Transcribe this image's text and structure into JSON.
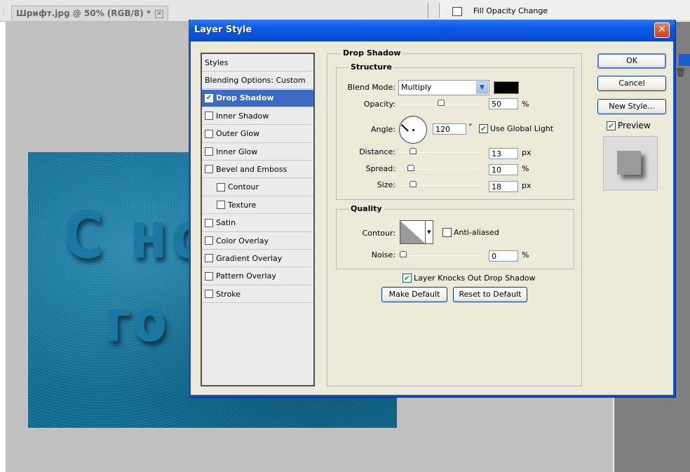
{
  "document_tab": {
    "title": "Шрифт.jpg @ 50% (RGB/8) *",
    "close_glyph": "✕"
  },
  "history": {
    "item": "Fill Opacity Change"
  },
  "canvas_text": {
    "line1": "С но",
    "line2": "го"
  },
  "dialog": {
    "title": "Layer Style",
    "close_glyph": "✕",
    "styles": [
      {
        "label": "Styles",
        "checkbox": false
      },
      {
        "label": "Blending Options: Custom",
        "checkbox": false
      },
      {
        "label": "Drop Shadow",
        "checkbox": true,
        "checked": true,
        "selected": true
      },
      {
        "label": "Inner Shadow",
        "checkbox": true,
        "checked": false
      },
      {
        "label": "Outer Glow",
        "checkbox": true,
        "checked": false
      },
      {
        "label": "Inner Glow",
        "checkbox": true,
        "checked": false
      },
      {
        "label": "Bevel and Emboss",
        "checkbox": true,
        "checked": false
      },
      {
        "label": "Contour",
        "checkbox": true,
        "checked": false,
        "indent": true
      },
      {
        "label": "Texture",
        "checkbox": true,
        "checked": false,
        "indent": true
      },
      {
        "label": "Satin",
        "checkbox": true,
        "checked": false
      },
      {
        "label": "Color Overlay",
        "checkbox": true,
        "checked": false
      },
      {
        "label": "Gradient Overlay",
        "checkbox": true,
        "checked": false
      },
      {
        "label": "Pattern Overlay",
        "checkbox": true,
        "checked": false
      },
      {
        "label": "Stroke",
        "checkbox": true,
        "checked": false
      }
    ],
    "drop_shadow": {
      "section_title": "Drop Shadow",
      "structure": {
        "title": "Structure",
        "blend_mode_label": "Blend Mode:",
        "blend_mode_value": "Multiply",
        "shadow_color": "#000000",
        "opacity_label": "Opacity:",
        "opacity_value": "50",
        "opacity_unit": "%",
        "opacity_fraction": 0.5,
        "angle_label": "Angle:",
        "angle_value": "120",
        "angle_unit": "°",
        "use_global_light_label": "Use Global Light",
        "use_global_light": true,
        "distance_label": "Distance:",
        "distance_value": "13",
        "distance_unit": "px",
        "spread_label": "Spread:",
        "spread_value": "10",
        "spread_unit": "%",
        "size_label": "Size:",
        "size_value": "18",
        "size_unit": "px"
      },
      "quality": {
        "title": "Quality",
        "contour_label": "Contour:",
        "anti_aliased_label": "Anti-aliased",
        "anti_aliased": false,
        "noise_label": "Noise:",
        "noise_value": "0",
        "noise_unit": "%"
      },
      "knocks_out_label": "Layer Knocks Out Drop Shadow",
      "knocks_out": true,
      "make_default_label": "Make Default",
      "reset_default_label": "Reset to Default"
    },
    "buttons": {
      "ok": "OK",
      "cancel": "Cancel",
      "new_style": "New Style...",
      "preview_label": "Preview",
      "preview": true
    }
  },
  "colors": {
    "titlebar": "#0a53d8",
    "selection": "#3c6bc3",
    "canvas_image": "#0f6f95"
  }
}
